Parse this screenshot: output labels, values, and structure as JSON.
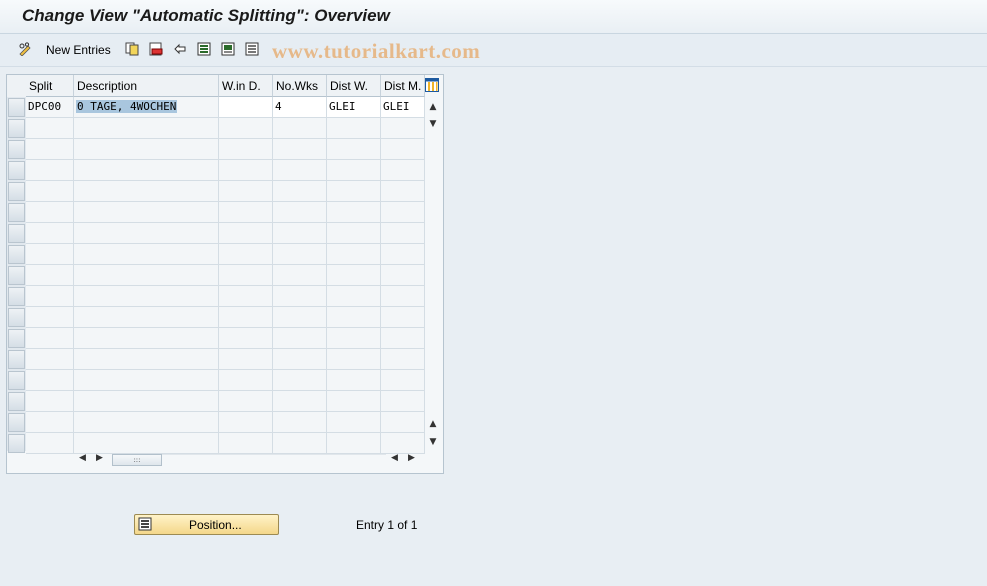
{
  "window": {
    "title": "Change View \"Automatic Splitting\": Overview"
  },
  "toolbar": {
    "new_entries_label": "New Entries",
    "icons": [
      "pencil-glasses-icon",
      "copy-icon",
      "delete-icon",
      "undo-icon",
      "select-all-icon",
      "select-block-icon",
      "deselect-all-icon"
    ]
  },
  "watermark": "www.tutorialkart.com",
  "table": {
    "columns": [
      "Split",
      "Description",
      "W.in D.",
      "No.Wks",
      "Dist W.",
      "Dist M."
    ],
    "rows": [
      [
        "DPC00",
        "0 TAGE, 4WOCHEN",
        "",
        "4",
        "GLEI",
        "GLEI"
      ]
    ],
    "visible_row_count": 17
  },
  "footer": {
    "position_button": "Position...",
    "entry_text": "Entry 1 of 1"
  }
}
